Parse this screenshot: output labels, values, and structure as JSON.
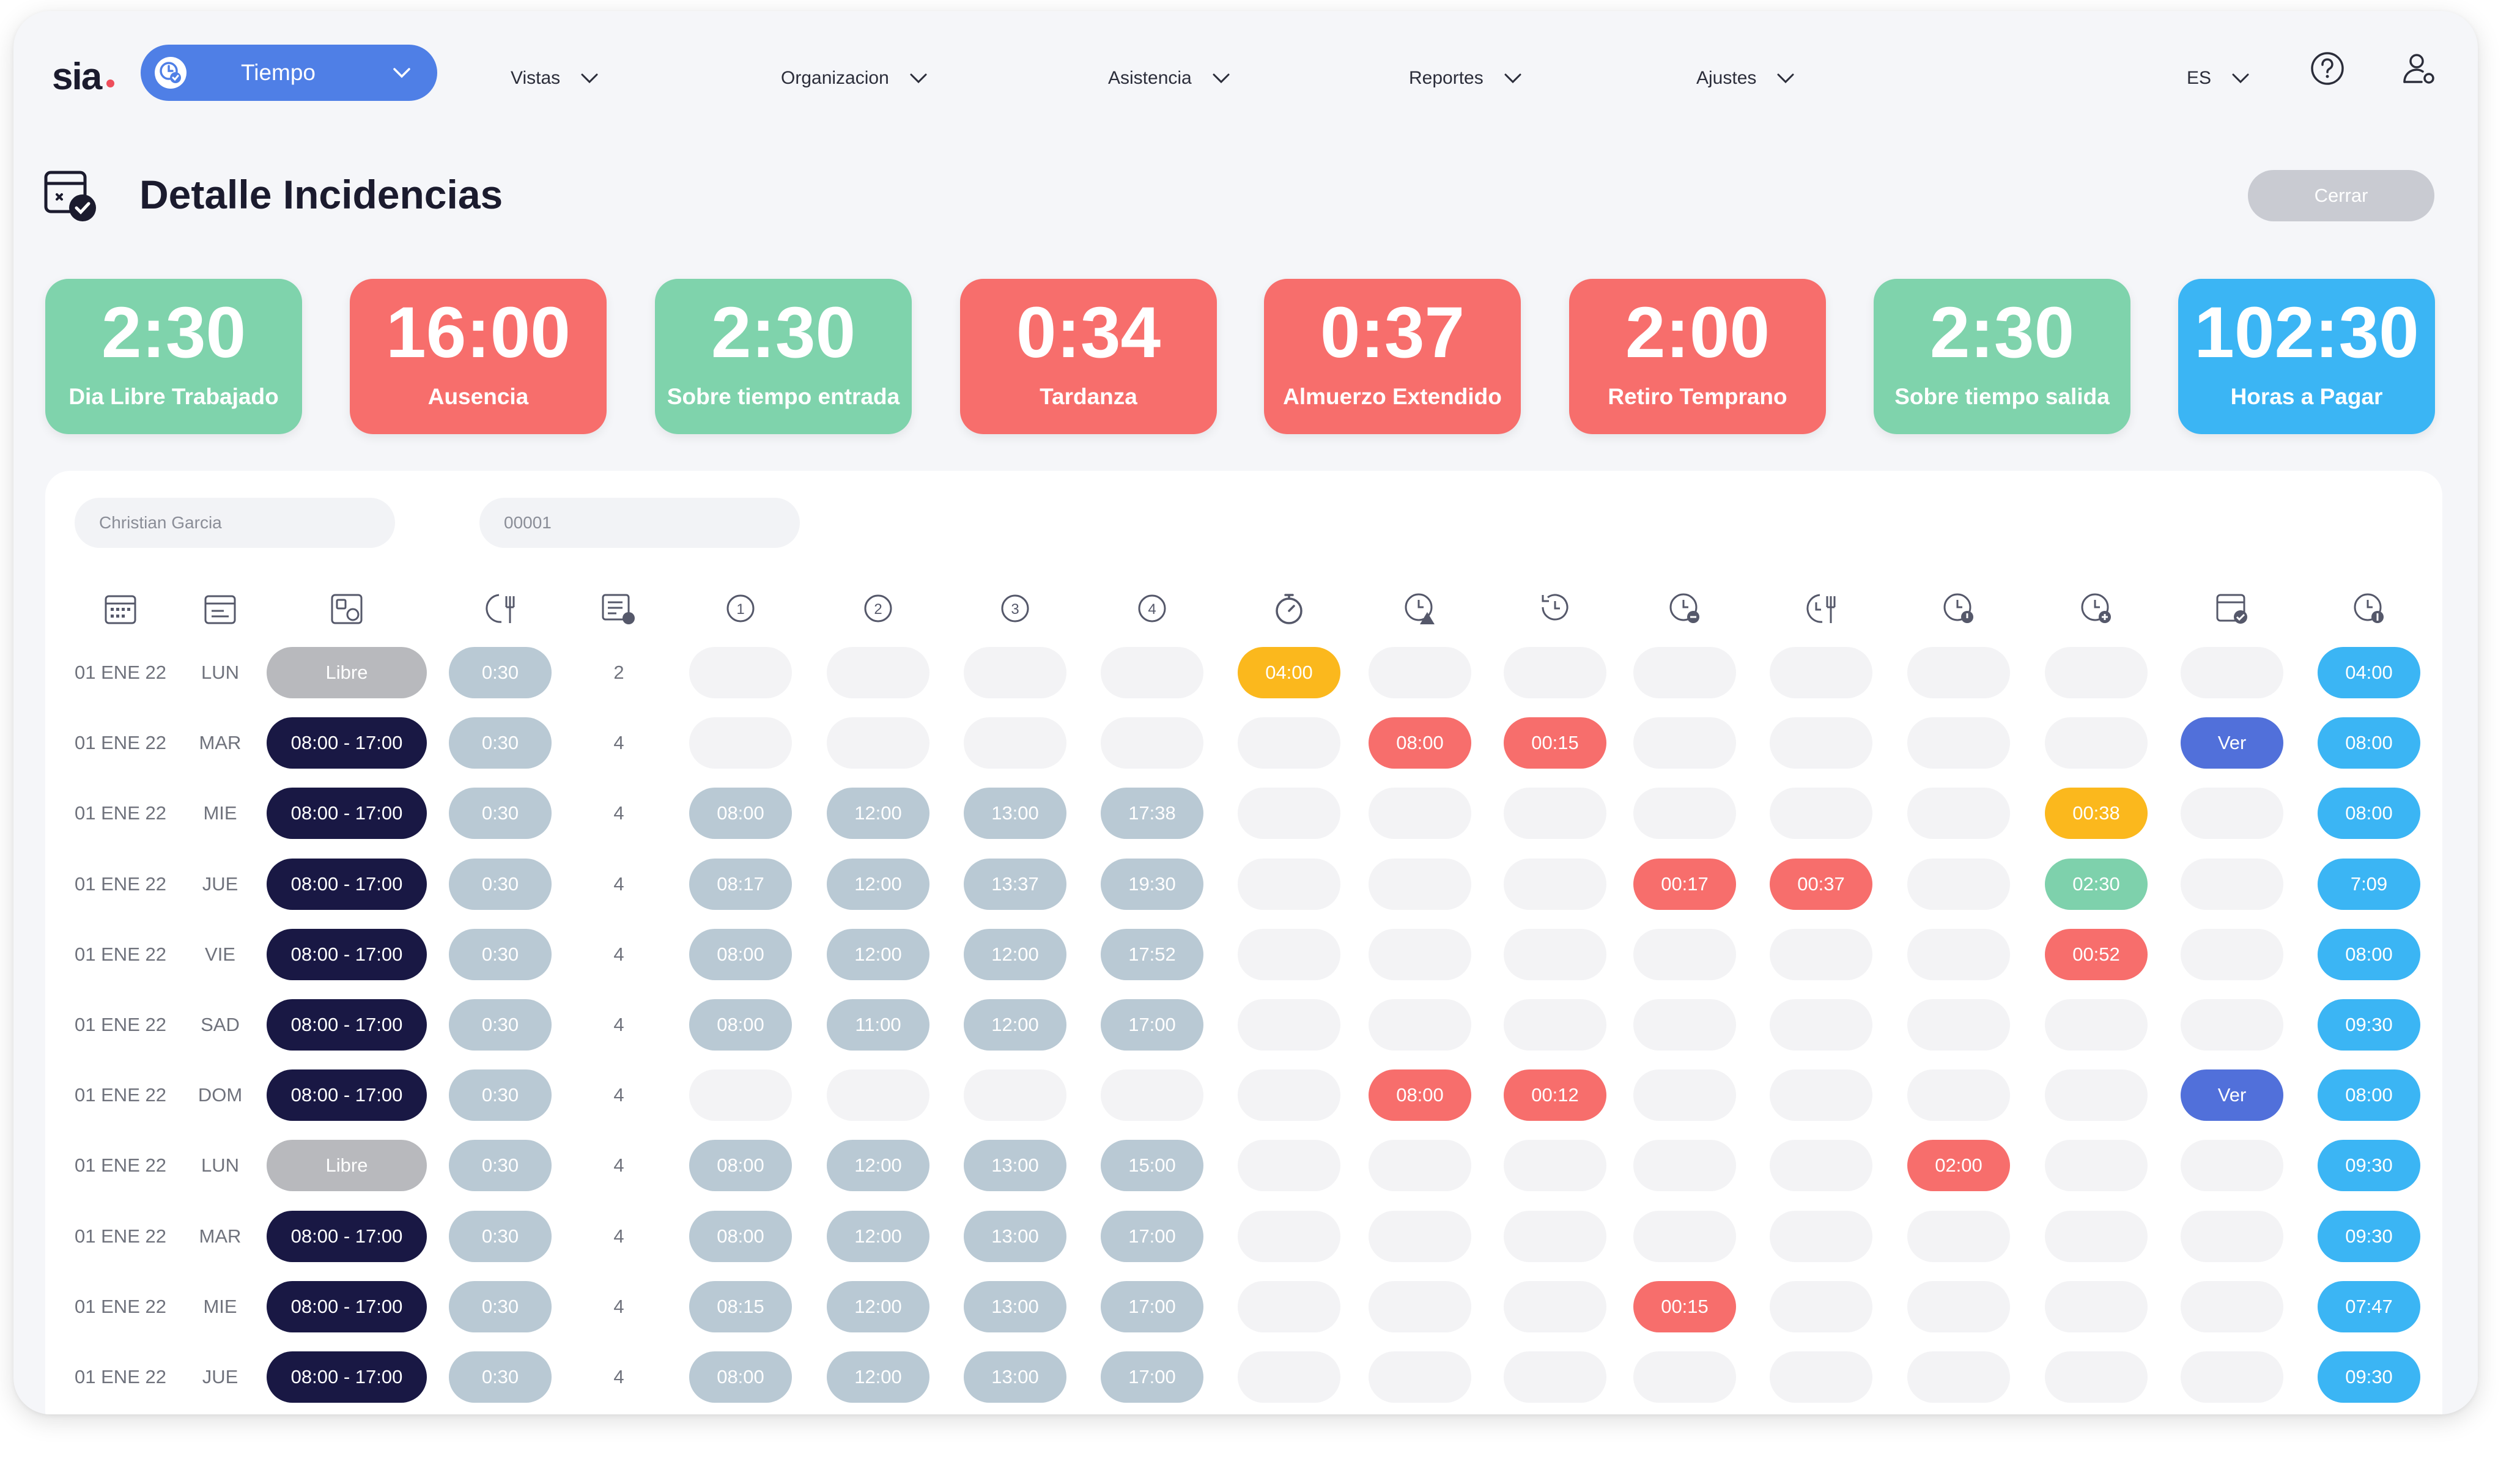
{
  "nav": {
    "logo": "sia",
    "module": "Tiempo",
    "menu": [
      "Vistas",
      "Organizacion",
      "Asistencia",
      "Reportes",
      "Ajustes"
    ],
    "language": "ES"
  },
  "header": {
    "title": "Detalle Incidencias",
    "close_label": "Cerrar"
  },
  "cards": [
    {
      "value": "2:30",
      "label": "Dia Libre Trabajado",
      "color": "#7fd3ac"
    },
    {
      "value": "16:00",
      "label": "Ausencia",
      "color": "#f76e6c"
    },
    {
      "value": "2:30",
      "label": "Sobre tiempo entrada",
      "color": "#7fd3ac"
    },
    {
      "value": "0:34",
      "label": "Tardanza",
      "color": "#f76e6c"
    },
    {
      "value": "0:37",
      "label": "Almuerzo Extendido",
      "color": "#f76e6c"
    },
    {
      "value": "2:00",
      "label": "Retiro Temprano",
      "color": "#f76e6c"
    },
    {
      "value": "2:30",
      "label": "Sobre tiempo salida",
      "color": "#7fd3ac"
    },
    {
      "value": "102:30",
      "label": "Horas a Pagar",
      "color": "#3bb5f4"
    }
  ],
  "filters": {
    "employee_name": "Christian Garcia",
    "employee_code": "00001"
  },
  "column_icons": [
    "calendar-icon",
    "day-card-icon",
    "schedule-icon",
    "lunch-clock-icon",
    "marks-count-icon",
    "mark-1-icon",
    "mark-2-icon",
    "mark-3-icon",
    "mark-4-icon",
    "stopwatch-icon",
    "clock-warning-icon",
    "clock-back-icon",
    "clock-minus-icon",
    "lunch-extended-icon",
    "clock-early-icon",
    "clock-plus-icon",
    "calendar-check-icon",
    "clock-pay-icon"
  ],
  "rows": [
    {
      "date": "01 ENE 22",
      "day": "LUN",
      "schedule": "Libre",
      "lunch": "0:30",
      "marks": "2",
      "m": [
        "",
        "",
        "",
        ""
      ],
      "inc": [
        [
          "04:00",
          "orange"
        ],
        [
          "",
          ""
        ],
        [
          "",
          ""
        ],
        [
          "",
          ""
        ],
        [
          "",
          ""
        ],
        [
          "",
          ""
        ],
        [
          "",
          ""
        ],
        [
          "",
          ""
        ]
      ],
      "pay": "04:00"
    },
    {
      "date": "01 ENE 22",
      "day": "MAR",
      "schedule": "08:00 - 17:00",
      "lunch": "0:30",
      "marks": "4",
      "m": [
        "",
        "",
        "",
        ""
      ],
      "inc": [
        [
          "",
          ""
        ],
        [
          "08:00",
          "red"
        ],
        [
          "00:15",
          "red"
        ],
        [
          "",
          ""
        ],
        [
          "",
          ""
        ],
        [
          "",
          ""
        ],
        [
          "",
          ""
        ],
        [
          "Ver",
          "ver"
        ]
      ],
      "pay": "08:00"
    },
    {
      "date": "01 ENE 22",
      "day": "MIE",
      "schedule": "08:00 - 17:00",
      "lunch": "0:30",
      "marks": "4",
      "m": [
        "08:00",
        "12:00",
        "13:00",
        "17:38"
      ],
      "inc": [
        [
          "",
          ""
        ],
        [
          "",
          ""
        ],
        [
          "",
          ""
        ],
        [
          "",
          ""
        ],
        [
          "",
          ""
        ],
        [
          "",
          ""
        ],
        [
          "00:38",
          "orange"
        ],
        [
          "",
          ""
        ]
      ],
      "pay": "08:00"
    },
    {
      "date": "01 ENE 22",
      "day": "JUE",
      "schedule": "08:00 - 17:00",
      "lunch": "0:30",
      "marks": "4",
      "m": [
        "08:17",
        "12:00",
        "13:37",
        "19:30"
      ],
      "inc": [
        [
          "",
          ""
        ],
        [
          "",
          ""
        ],
        [
          "",
          ""
        ],
        [
          "00:17",
          "red"
        ],
        [
          "00:37",
          "red"
        ],
        [
          "",
          ""
        ],
        [
          "02:30",
          "teal"
        ],
        [
          "",
          ""
        ]
      ],
      "pay": "7:09"
    },
    {
      "date": "01 ENE 22",
      "day": "VIE",
      "schedule": "08:00 - 17:00",
      "lunch": "0:30",
      "marks": "4",
      "m": [
        "08:00",
        "12:00",
        "12:00",
        "17:52"
      ],
      "inc": [
        [
          "",
          ""
        ],
        [
          "",
          ""
        ],
        [
          "",
          ""
        ],
        [
          "",
          ""
        ],
        [
          "",
          ""
        ],
        [
          "",
          ""
        ],
        [
          "00:52",
          "red"
        ],
        [
          "",
          ""
        ]
      ],
      "pay": "08:00"
    },
    {
      "date": "01 ENE 22",
      "day": "SAD",
      "schedule": "08:00 - 17:00",
      "lunch": "0:30",
      "marks": "4",
      "m": [
        "08:00",
        "11:00",
        "12:00",
        "17:00"
      ],
      "inc": [
        [
          "",
          ""
        ],
        [
          "",
          ""
        ],
        [
          "",
          ""
        ],
        [
          "",
          ""
        ],
        [
          "",
          ""
        ],
        [
          "",
          ""
        ],
        [
          "",
          ""
        ],
        [
          "",
          ""
        ]
      ],
      "pay": "09:30"
    },
    {
      "date": "01 ENE 22",
      "day": "DOM",
      "schedule": "08:00 - 17:00",
      "lunch": "0:30",
      "marks": "4",
      "m": [
        "",
        "",
        "",
        ""
      ],
      "inc": [
        [
          "",
          ""
        ],
        [
          "08:00",
          "red"
        ],
        [
          "00:12",
          "red"
        ],
        [
          "",
          ""
        ],
        [
          "",
          ""
        ],
        [
          "",
          ""
        ],
        [
          "",
          ""
        ],
        [
          "Ver",
          "ver"
        ]
      ],
      "pay": "08:00"
    },
    {
      "date": "01 ENE 22",
      "day": "LUN",
      "schedule": "Libre",
      "lunch": "0:30",
      "marks": "4",
      "m": [
        "08:00",
        "12:00",
        "13:00",
        "15:00"
      ],
      "inc": [
        [
          "",
          ""
        ],
        [
          "",
          ""
        ],
        [
          "",
          ""
        ],
        [
          "",
          ""
        ],
        [
          "",
          ""
        ],
        [
          "02:00",
          "red"
        ],
        [
          "",
          ""
        ],
        [
          "",
          ""
        ]
      ],
      "pay": "09:30"
    },
    {
      "date": "01 ENE 22",
      "day": "MAR",
      "schedule": "08:00 - 17:00",
      "lunch": "0:30",
      "marks": "4",
      "m": [
        "08:00",
        "12:00",
        "13:00",
        "17:00"
      ],
      "inc": [
        [
          "",
          ""
        ],
        [
          "",
          ""
        ],
        [
          "",
          ""
        ],
        [
          "",
          ""
        ],
        [
          "",
          ""
        ],
        [
          "",
          ""
        ],
        [
          "",
          ""
        ],
        [
          "",
          ""
        ]
      ],
      "pay": "09:30"
    },
    {
      "date": "01 ENE 22",
      "day": "MIE",
      "schedule": "08:00 - 17:00",
      "lunch": "0:30",
      "marks": "4",
      "m": [
        "08:15",
        "12:00",
        "13:00",
        "17:00"
      ],
      "inc": [
        [
          "",
          ""
        ],
        [
          "",
          ""
        ],
        [
          "",
          ""
        ],
        [
          "00:15",
          "red"
        ],
        [
          "",
          ""
        ],
        [
          "",
          ""
        ],
        [
          "",
          ""
        ],
        [
          "",
          ""
        ]
      ],
      "pay": "07:47"
    },
    {
      "date": "01 ENE 22",
      "day": "JUE",
      "schedule": "08:00 - 17:00",
      "lunch": "0:30",
      "marks": "4",
      "m": [
        "08:00",
        "12:00",
        "13:00",
        "17:00"
      ],
      "inc": [
        [
          "",
          ""
        ],
        [
          "",
          ""
        ],
        [
          "",
          ""
        ],
        [
          "",
          ""
        ],
        [
          "",
          ""
        ],
        [
          "",
          ""
        ],
        [
          "",
          ""
        ],
        [
          "",
          ""
        ]
      ],
      "pay": "09:30"
    }
  ]
}
